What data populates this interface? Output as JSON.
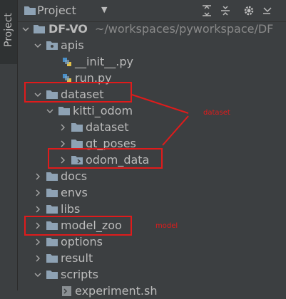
{
  "sidebar": {
    "tab_label": "Project"
  },
  "header": {
    "title": "Project",
    "icons": [
      "collapse-all-icon",
      "expand-all-icon",
      "gear-icon",
      "hide-icon"
    ]
  },
  "tree": {
    "root": {
      "name": "DF-VO",
      "path": "~/workspaces/pyworkspace/DF"
    },
    "apis": "apis",
    "init_py": "__init__.py",
    "run_py": "run.py",
    "dataset": "dataset",
    "kitti_odom": "kitti_odom",
    "kitti_dataset": "dataset",
    "gt_poses": "gt_poses",
    "odom_data": "odom_data",
    "docs": "docs",
    "envs": "envs",
    "libs": "libs",
    "model_zoo": "model_zoo",
    "options": "options",
    "result": "result",
    "scripts": "scripts",
    "experiment_sh": "experiment.sh"
  },
  "annotations": {
    "dataset_note": "dataset",
    "model_note": "model",
    "color": "#e01b1b"
  }
}
